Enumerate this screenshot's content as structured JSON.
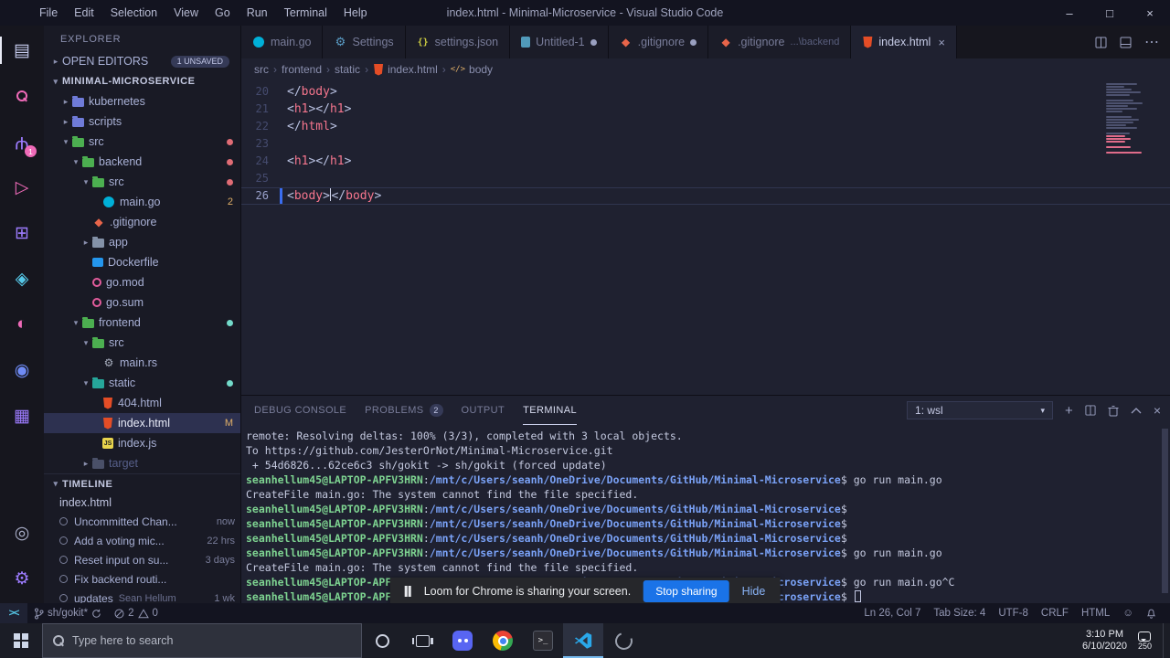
{
  "titlebar": {
    "menus": [
      "File",
      "Edit",
      "Selection",
      "View",
      "Go",
      "Run",
      "Terminal",
      "Help"
    ],
    "title": "index.html - Minimal-Microservice - Visual Studio Code"
  },
  "activity_bar": [
    {
      "name": "explorer",
      "color": "#c8cdf0",
      "active": true
    },
    {
      "name": "search",
      "color": "#ef6ab8"
    },
    {
      "name": "source-control",
      "color": "#9d7cff",
      "badge": "1"
    },
    {
      "name": "run-debug",
      "color": "#ef6ab8"
    },
    {
      "name": "extensions",
      "color": "#9d7cff"
    },
    {
      "name": "remote-explorer",
      "color": "#56c8e8"
    },
    {
      "name": "test",
      "color": "#ef6ab8"
    },
    {
      "name": "docker",
      "color": "#6f8bf5"
    },
    {
      "name": "kubernetes",
      "color": "#9d7cff"
    },
    {
      "name": "accounts",
      "color": "#a9aec8",
      "bottom": true
    },
    {
      "name": "settings",
      "color": "#9d7cff",
      "bottom": true
    }
  ],
  "explorer": {
    "title": "EXPLORER",
    "open_editors_label": "OPEN EDITORS",
    "unsaved_badge": "1 UNSAVED",
    "root": "MINIMAL-MICROSERVICE",
    "items": [
      {
        "label": "kubernetes",
        "type": "folder",
        "collapsed": true,
        "indent": 1,
        "color": "#6f7bd8"
      },
      {
        "label": "scripts",
        "type": "folder",
        "collapsed": true,
        "indent": 1,
        "color": "#6f7bd8"
      },
      {
        "label": "src",
        "type": "folder",
        "indent": 1,
        "color": "#4caf50",
        "dot": "#e06c75"
      },
      {
        "label": "backend",
        "type": "folder",
        "indent": 2,
        "color": "#4caf50",
        "dot": "#e06c75"
      },
      {
        "label": "src",
        "type": "folder",
        "indent": 3,
        "color": "#4caf50",
        "dot": "#e06c75"
      },
      {
        "label": "main.go",
        "type": "file",
        "icon": "go",
        "indent": 4,
        "badge": "2"
      },
      {
        "label": ".gitignore",
        "type": "file",
        "icon": "git",
        "indent": 3
      },
      {
        "label": "app",
        "type": "folder",
        "collapsed": true,
        "indent": 3,
        "color": "#8492a8"
      },
      {
        "label": "Dockerfile",
        "type": "file",
        "icon": "docker",
        "indent": 3
      },
      {
        "label": "go.mod",
        "type": "file",
        "icon": "gomod",
        "indent": 3
      },
      {
        "label": "go.sum",
        "type": "file",
        "icon": "gomod",
        "indent": 3
      },
      {
        "label": "frontend",
        "type": "folder",
        "indent": 2,
        "color": "#4caf50",
        "dot": "#73daca"
      },
      {
        "label": "src",
        "type": "folder",
        "indent": 3,
        "color": "#4caf50"
      },
      {
        "label": "main.rs",
        "type": "file",
        "icon": "rust",
        "indent": 4
      },
      {
        "label": "static",
        "type": "folder",
        "indent": 3,
        "color": "#26a69a",
        "dot": "#73daca"
      },
      {
        "label": "404.html",
        "type": "file",
        "icon": "html",
        "indent": 4
      },
      {
        "label": "index.html",
        "type": "file",
        "icon": "html",
        "indent": 4,
        "badge": "M",
        "selected": true
      },
      {
        "label": "index.js",
        "type": "file",
        "icon": "js",
        "indent": 4
      },
      {
        "label": "target",
        "type": "folder",
        "collapsed": true,
        "indent": 3,
        "color": "#4a5068",
        "faded": true
      }
    ]
  },
  "timeline": {
    "label": "TIMELINE",
    "file": "index.html",
    "items": [
      {
        "label": "Uncommitted Chan...",
        "author": "",
        "time": "now"
      },
      {
        "label": "Add a voting mic...",
        "author": "",
        "time": "22 hrs"
      },
      {
        "label": "Reset input on su...",
        "author": "",
        "time": "3 days"
      },
      {
        "label": "Fix backend routi...",
        "author": "",
        "time": ""
      },
      {
        "label": "updates",
        "author": "Sean Hellum",
        "time": "1 wk"
      }
    ]
  },
  "tab_bar": {
    "tabs": [
      {
        "label": "main.go",
        "icon": "go"
      },
      {
        "label": "Settings",
        "icon": "gear"
      },
      {
        "label": "settings.json",
        "icon": "json"
      },
      {
        "label": "Untitled-1",
        "icon": "file",
        "dirty": true
      },
      {
        "label": ".gitignore",
        "icon": "git",
        "dirty": true
      },
      {
        "label": ".gitignore",
        "icon": "git",
        "desc": "...\\backend"
      },
      {
        "label": "index.html",
        "icon": "html",
        "active": true
      }
    ]
  },
  "breadcrumbs": [
    "src",
    "frontend",
    "static",
    "index.html",
    "body"
  ],
  "editor": {
    "lines": [
      {
        "num": "20",
        "tokens": [
          [
            "p",
            "</"
          ],
          [
            "t",
            "body"
          ],
          [
            "p",
            ">"
          ]
        ]
      },
      {
        "num": "21",
        "tokens": [
          [
            "p",
            "<"
          ],
          [
            "t",
            "h1"
          ],
          [
            "p",
            ">"
          ],
          [
            "p",
            "</"
          ],
          [
            "t",
            "h1"
          ],
          [
            "p",
            ">"
          ]
        ]
      },
      {
        "num": "22",
        "tokens": [
          [
            "p",
            "</"
          ],
          [
            "t",
            "html"
          ],
          [
            "p",
            ">"
          ]
        ]
      },
      {
        "num": "23",
        "tokens": []
      },
      {
        "num": "24",
        "tokens": [
          [
            "p",
            "<"
          ],
          [
            "t",
            "h1"
          ],
          [
            "p",
            ">"
          ],
          [
            "p",
            "</"
          ],
          [
            "t",
            "h1"
          ],
          [
            "p",
            ">"
          ]
        ]
      },
      {
        "num": "25",
        "tokens": []
      },
      {
        "num": "26",
        "tokens": [
          [
            "p",
            "<"
          ],
          [
            "t",
            "body"
          ],
          [
            "p",
            ">"
          ],
          [
            "c",
            ""
          ],
          [
            "p",
            "</"
          ],
          [
            "t",
            "body"
          ],
          [
            "p",
            ">"
          ]
        ],
        "current": true
      }
    ],
    "cursor_position": "Ln 26, Col 7"
  },
  "panel": {
    "tabs": [
      {
        "label": "DEBUG CONSOLE"
      },
      {
        "label": "PROBLEMS",
        "badge": "2"
      },
      {
        "label": "OUTPUT"
      },
      {
        "label": "TERMINAL",
        "active": true
      }
    ],
    "shell_selector": "1: wsl",
    "terminal": {
      "prompt_user": "seanhellum45@LAPTOP-APFV3HRN",
      "prompt_path": "/mnt/c/Users/seanh/OneDrive/Documents/GitHub/Minimal-Microservice",
      "lines": [
        {
          "segs": [
            [
              "plain",
              "remote: Resolving deltas: 100% (3/3), completed with 3 local objects."
            ]
          ]
        },
        {
          "segs": [
            [
              "plain",
              "To https://github.com/JesterOrNot/Minimal-Microservice.git"
            ]
          ]
        },
        {
          "segs": [
            [
              "plain",
              " + 54d6826...62ce6c3 sh/gokit -> sh/gokit (forced update)"
            ]
          ]
        },
        {
          "prompt": true,
          "cmd": " go run main.go"
        },
        {
          "segs": [
            [
              "plain",
              "CreateFile main.go: The system cannot find the file specified."
            ]
          ]
        },
        {
          "prompt": true,
          "cmd": ""
        },
        {
          "prompt": true,
          "cmd": ""
        },
        {
          "prompt": true,
          "cmd": ""
        },
        {
          "prompt": true,
          "cmd": " go run main.go"
        },
        {
          "segs": [
            [
              "plain",
              "CreateFile main.go: The system cannot find the file specified."
            ]
          ]
        },
        {
          "prompt": true,
          "cmd": " go run main.go^C"
        },
        {
          "prompt": true,
          "cmd": " ",
          "cursor": true
        }
      ]
    }
  },
  "loom_bar": {
    "message": "Loom for Chrome is sharing your screen.",
    "stop_button": "Stop sharing",
    "hide_button": "Hide"
  },
  "status_bar": {
    "branch": "sh/gokit*",
    "error_count": "2",
    "warning_count": "0",
    "right_items": [
      "Ln 26, Col 7",
      "Tab Size: 4",
      "UTF-8",
      "CRLF",
      "HTML"
    ]
  },
  "taskbar": {
    "search_placeholder": "Type here to search",
    "time": "3:10 PM",
    "date": "6/10/2020",
    "notification_count": "250",
    "apps": [
      "cortana",
      "task-view",
      "discord",
      "chrome",
      "terminal",
      "vscode",
      "loading"
    ]
  }
}
